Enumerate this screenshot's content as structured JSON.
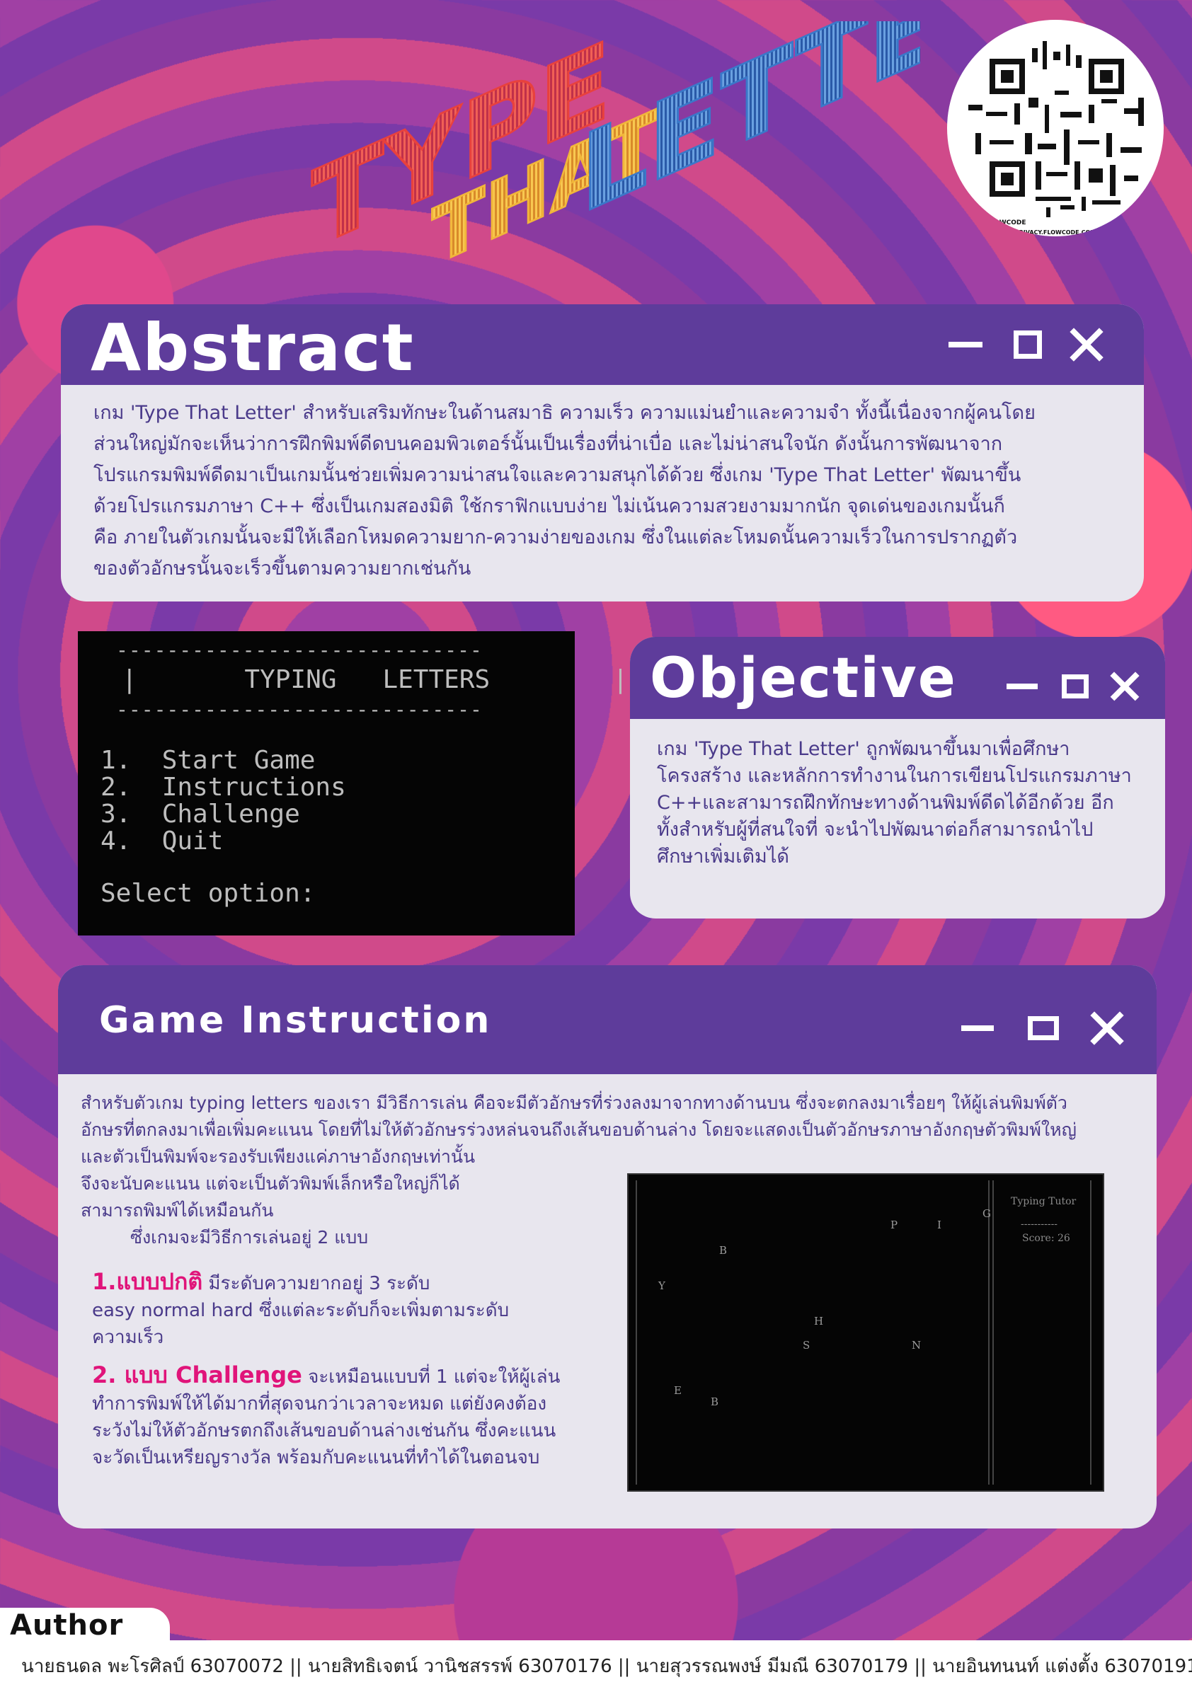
{
  "poster": {
    "title_word_1": "TYPE",
    "title_word_2": "THAT",
    "title_word_3": "LETTERS",
    "colors": {
      "type": "#e8413d",
      "that": "#f1b63a",
      "letters": "#3a78c9",
      "panel_bar": "#5e3c9b",
      "panel_body": "#e8e6ee",
      "accent": "#e0147a"
    }
  },
  "qr": {
    "flowcode_label": "FLOWCODE",
    "privacy_label": "PRIVACY.FLOWCODE.COM"
  },
  "abstract": {
    "title": "Abstract",
    "lines": [
      "เกม 'Type That Letter' สำหรับเสริมทักษะในด้านสมาธิ ความเร็ว ความแม่นยำและความจำ ทั้งนี้เนื่องจากผู้คนโดย",
      "ส่วนใหญ่มักจะเห็นว่าการฝึกพิมพ์ดีดบนคอมพิวเตอร์นั้นเป็นเรื่องที่น่าเบื่อ และไม่น่าสนใจนัก ดังนั้นการพัฒนาจาก",
      "โปรแกรมพิมพ์ดีดมาเป็นเกมนั้นช่วยเพิ่มความน่าสนใจและความสนุกได้ด้วย ซึ่งเกม 'Type That Letter' พัฒนาขึ้น",
      "ด้วยโปรแกรมภาษา C++ ซึ่งเป็นเกมสองมิติ ใช้กราฟิกแบบง่าย ไม่เน้นความสวยงามมากนัก จุดเด่นของเกมนั้นก็",
      "คือ ภายในตัวเกมนั้นจะมีให้เลือกโหมดความยาก-ความง่ายของเกม ซึ่งในแต่ละโหมดนั้นความเร็วในการปรากฏตัว",
      "ของตัวอักษรนั้นจะเร็วขึ้นตามความยากเช่นกัน"
    ]
  },
  "menu_terminal": {
    "dashes": "-----------------------------",
    "title": "|       TYPING   LETTERS        |",
    "items": [
      "1.  Start Game",
      "2.  Instructions",
      "3.  Challenge",
      "4.  Quit"
    ],
    "prompt": "Select option:"
  },
  "objective": {
    "title": "Objective",
    "lines": [
      "เกม 'Type That Letter' ถูกพัฒนาขึ้นมาเพื่อศึกษา",
      "โครงสร้าง และหลักการทำงานในการเขียนโปรแกรมภาษา",
      "C++และสามารถฝึกทักษะทางด้านพิมพ์ดีดได้อีกด้วย อีก",
      "ทั้งสำหรับผู้ที่สนใจที่ จะนำไปพัฒนาต่อก็สามารถนำไป",
      "ศึกษาเพิ่มเติมได้"
    ]
  },
  "instruction": {
    "title": "Game Instruction",
    "lines_full": [
      "สำหรับตัวเกม typing letters ของเรา มีวิธีการเล่น คือจะมีตัวอักษรที่ร่วงลงมาจากทางด้านบน ซึ่งจะตกลงมาเรื่อยๆ ให้ผู้เล่นพิมพ์ตัว",
      "อักษรที่ตกลงมาเพื่อเพิ่มคะแนน โดยที่ไม่ให้ตัวอักษรร่วงหล่นจนถึงเส้นขอบด้านล่าง โดยจะแสดงเป็นตัวอักษรภาษาอังกฤษตัวพิมพ์ใหญ่",
      "และตัวเป็นพิมพ์จะรองรับเพียงแค่ภาษาอังกฤษเท่านั้น"
    ],
    "lines_left": [
      "จึงจะนับคะแนน แต่จะเป็นตัวพิมพ์เล็กหรือใหญ่ก็ได้",
      "สามารถพิมพ์ได้เหมือนกัน"
    ],
    "modes_intro": "ซึ่งเกมจะมีวิธีการเล่นอยู่ 2 แบบ",
    "mode1_head": "1.แบบปกติ",
    "mode1_lines": [
      " มีระดับความยากอยู่ 3 ระดับ",
      "easy normal hard ซึ่งแต่ละระดับก็จะเพิ่มตามระดับ",
      "ความเร็ว"
    ],
    "mode2_head": "2. แบบ Challenge",
    "mode2_lines": [
      " จะเหมือนแบบที่ 1 แต่จะให้ผู้เล่น",
      "ทำการพิมพ์ให้ได้มากที่สุดจนกว่าเวลาจะหมด แต่ยังคงต้อง",
      "ระวังไม่ให้ตัวอักษรตกถึงเส้นขอบด้านล่างเช่นกัน ซึ่งคะแนน",
      "จะวัดเป็นเหรียญรางวัล พร้อมกับคะแนนที่ทำได้ในตอนจบ"
    ]
  },
  "game_terminal": {
    "letters": [
      "P",
      "I",
      "G",
      "B",
      "Y",
      "H",
      "S",
      "N",
      "E",
      "B"
    ],
    "side_title": "Typing Tutor",
    "side_rule": "-----------",
    "score": "Score: 26"
  },
  "author": {
    "label": "Author",
    "names": "นายธนดล พะโรศิลป์ 63070072 || นายสิทธิเจตน์ วานิชสรรพ์ 63070176 || นายสุวรรณพงษ์ มีมณี 63070179 || นายอินทนนท์ แต่งตั้ง 63070191"
  }
}
